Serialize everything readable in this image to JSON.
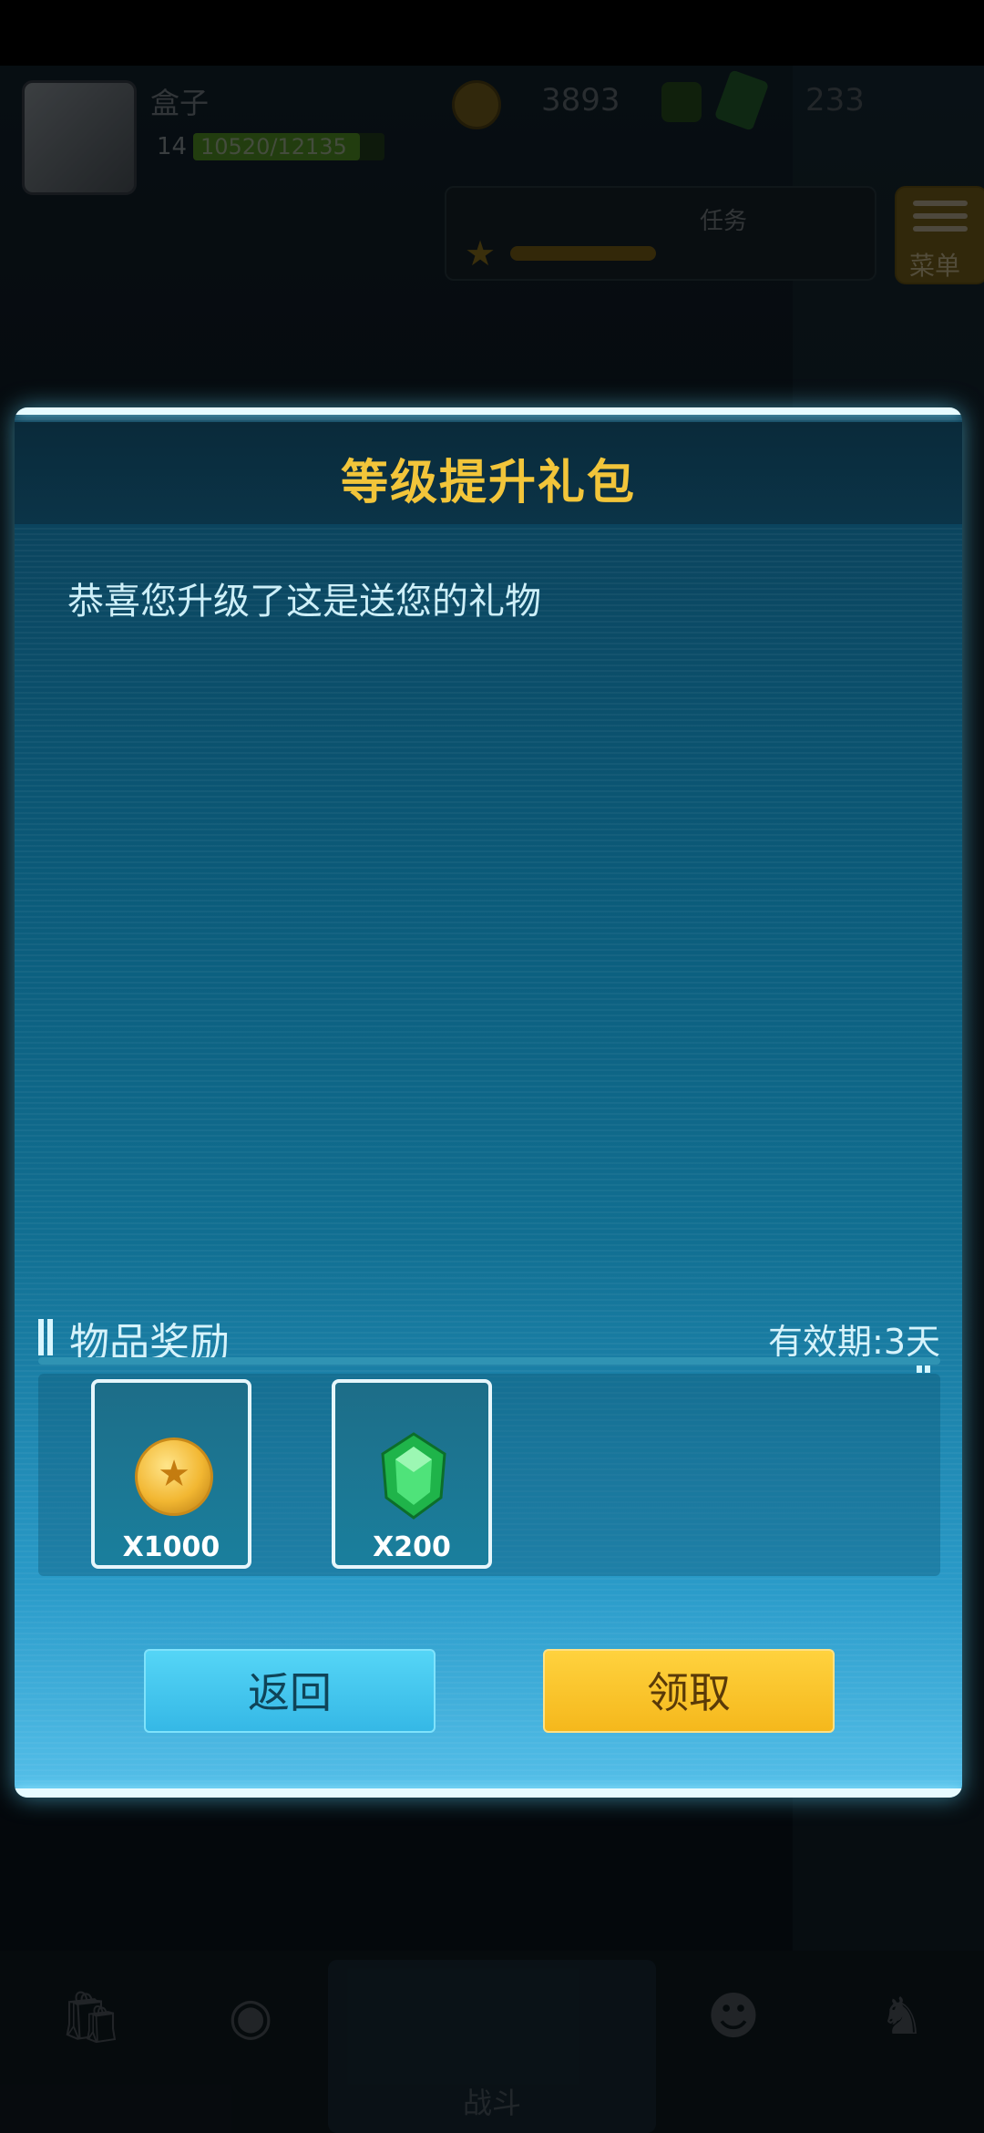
{
  "background": {
    "player_name": "盒子",
    "player_level": "14",
    "xp_text": "10520/12135",
    "xp_progress": 0.87,
    "coin_balance": "3893",
    "gem_balance": "233",
    "task_label": "任务",
    "menu_label": "菜单",
    "battle_label": "战斗"
  },
  "dialog": {
    "title": "等级提升礼包",
    "message": "恭喜您升级了这是送您的礼物",
    "reward_section_title": "物品奖励",
    "validity": "有效期:3天",
    "items": [
      {
        "icon": "gold-coin-icon",
        "quantity": "X1000"
      },
      {
        "icon": "green-gem-icon",
        "quantity": "X200"
      }
    ],
    "back_button": "返回",
    "claim_button": "领取"
  },
  "colors": {
    "title": "#f2c53a",
    "claim_button": "#f5b81c",
    "back_button": "#35b8e6",
    "dialog_glow": "#8fe6ff"
  }
}
